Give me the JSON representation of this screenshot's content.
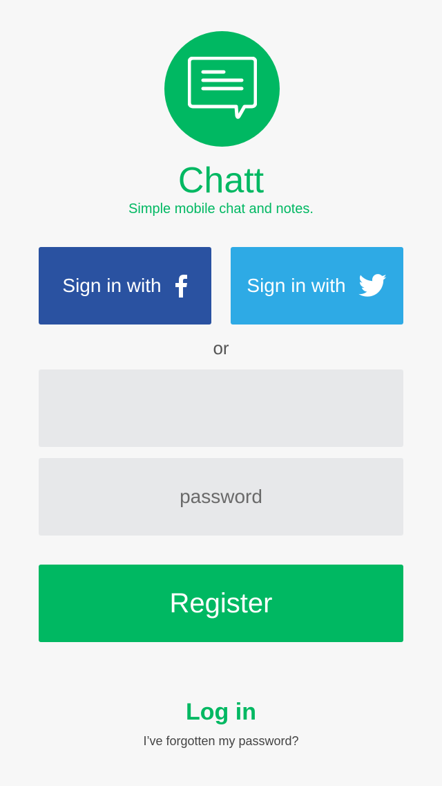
{
  "colors": {
    "brand": "#00b862",
    "facebook": "#2a52a1",
    "twitter": "#2eaae5",
    "background": "#f7f7f7",
    "field": "#e7e8ea"
  },
  "logo": {
    "icon": "chat-bubble-icon"
  },
  "app": {
    "name": "Chatt",
    "tagline": "Simple mobile chat and notes."
  },
  "social": {
    "facebook": {
      "label": "Sign in with",
      "icon": "facebook-icon"
    },
    "twitter": {
      "label": "Sign in with",
      "icon": "twitter-icon"
    }
  },
  "separator": "or",
  "form": {
    "email": {
      "value": "",
      "placeholder": ""
    },
    "password": {
      "value": "",
      "placeholder": "password"
    },
    "register_label": "Register"
  },
  "footer": {
    "login_label": "Log in",
    "forgot_label": "I’ve forgotten my password?"
  }
}
